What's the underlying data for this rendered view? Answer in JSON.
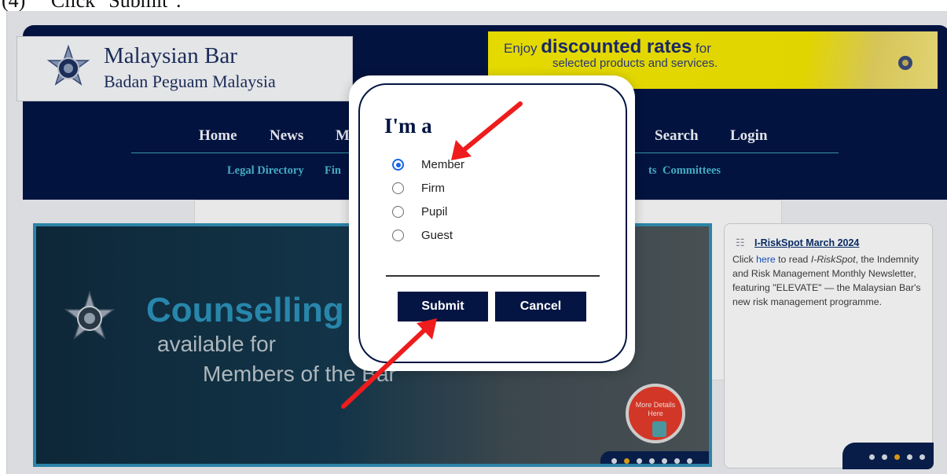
{
  "caption": "(4)     Click \"Submit\".",
  "header": {
    "logo_title": "Malaysian Bar",
    "logo_subtitle": "Badan Peguam Malaysia"
  },
  "promo": {
    "prefix": "Enjoy ",
    "highlight": "discounted rates",
    "suffix": " for",
    "line2": "selected products and services."
  },
  "nav": {
    "items": [
      "Home",
      "News",
      "M",
      "Search",
      "Login"
    ]
  },
  "subnav": {
    "items": [
      "Legal Directory",
      "Fin",
      "ts",
      "Committees"
    ]
  },
  "hero": {
    "title": "Counselling",
    "line2": "available for",
    "line3": "Members of the Bar",
    "more_btn": "More Details Here"
  },
  "side_card": {
    "title": "I-RiskSpot March 2024",
    "body_prefix": "Click ",
    "link": "here",
    "body_mid": " to read ",
    "italic": "I-RiskSpot",
    "body_suffix": ", the Indemnity and Risk Management Monthly Newsletter, featuring \"ELEVATE\" — the Malaysian Bar's new risk management programme."
  },
  "modal": {
    "title": "I'm a",
    "options": [
      {
        "label": "Member",
        "checked": true
      },
      {
        "label": "Firm",
        "checked": false
      },
      {
        "label": "Pupil",
        "checked": false
      },
      {
        "label": "Guest",
        "checked": false
      }
    ],
    "submit_label": "Submit",
    "cancel_label": "Cancel"
  },
  "colors": {
    "navy": "#041543",
    "accent_blue": "#1565e8",
    "arrow_red": "#ee1c1c",
    "promo_yellow": "#f3e800"
  }
}
